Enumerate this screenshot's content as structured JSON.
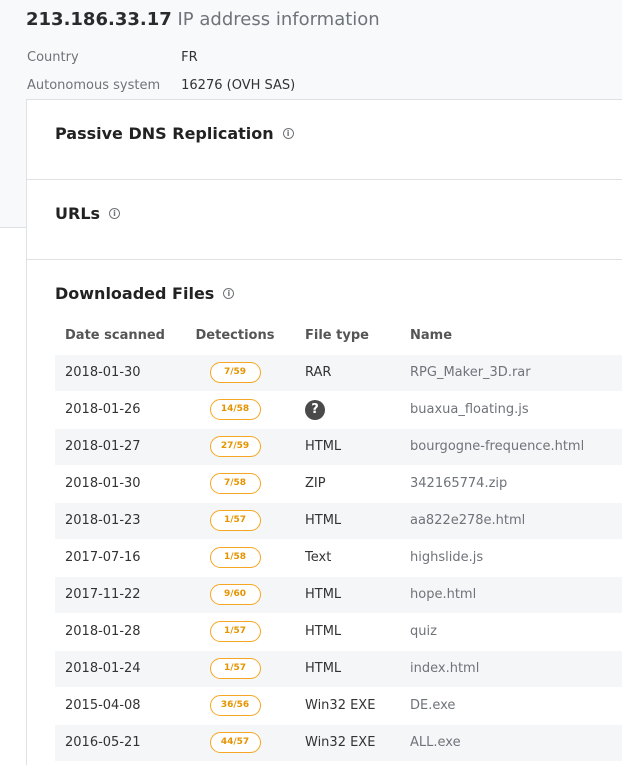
{
  "header": {
    "ip": "213.186.33.17",
    "subtitle": "IP address information",
    "country_label": "Country",
    "country_value": "FR",
    "as_label": "Autonomous system",
    "as_value": "16276 (OVH SAS)"
  },
  "sections": {
    "passive_dns": "Passive DNS Replication",
    "urls": "URLs",
    "downloaded_files": "Downloaded Files"
  },
  "info_icon_glyph": "i",
  "table": {
    "headers": [
      "Date scanned",
      "Detections",
      "File type",
      "Name"
    ],
    "rows": [
      {
        "date": "2018-01-30",
        "detections": "7/59",
        "type": "RAR",
        "name": "RPG_Maker_3D.rar"
      },
      {
        "date": "2018-01-26",
        "detections": "14/58",
        "type": "",
        "type_icon": "question-icon",
        "name": "buaxua_floating.js"
      },
      {
        "date": "2018-01-27",
        "detections": "27/59",
        "type": "HTML",
        "name": "bourgogne-frequence.html"
      },
      {
        "date": "2018-01-30",
        "detections": "7/58",
        "type": "ZIP",
        "name": "342165774.zip"
      },
      {
        "date": "2018-01-23",
        "detections": "1/57",
        "type": "HTML",
        "name": "aa822e278e.html"
      },
      {
        "date": "2017-07-16",
        "detections": "1/58",
        "type": "Text",
        "name": "highslide.js"
      },
      {
        "date": "2017-11-22",
        "detections": "9/60",
        "type": "HTML",
        "name": "hope.html"
      },
      {
        "date": "2018-01-28",
        "detections": "1/57",
        "type": "HTML",
        "name": "quiz"
      },
      {
        "date": "2018-01-24",
        "detections": "1/57",
        "type": "HTML",
        "name": "index.html"
      },
      {
        "date": "2015-04-08",
        "detections": "36/56",
        "type": "Win32 EXE",
        "name": "DE.exe"
      },
      {
        "date": "2016-05-21",
        "detections": "44/57",
        "type": "Win32 EXE",
        "name": "ALL.exe"
      }
    ]
  },
  "question_glyph": "?",
  "colors": {
    "badge_border": "#f5a623",
    "badge_text": "#e59400",
    "muted_text": "#6f737a",
    "row_stripe": "#f5f6f7"
  }
}
